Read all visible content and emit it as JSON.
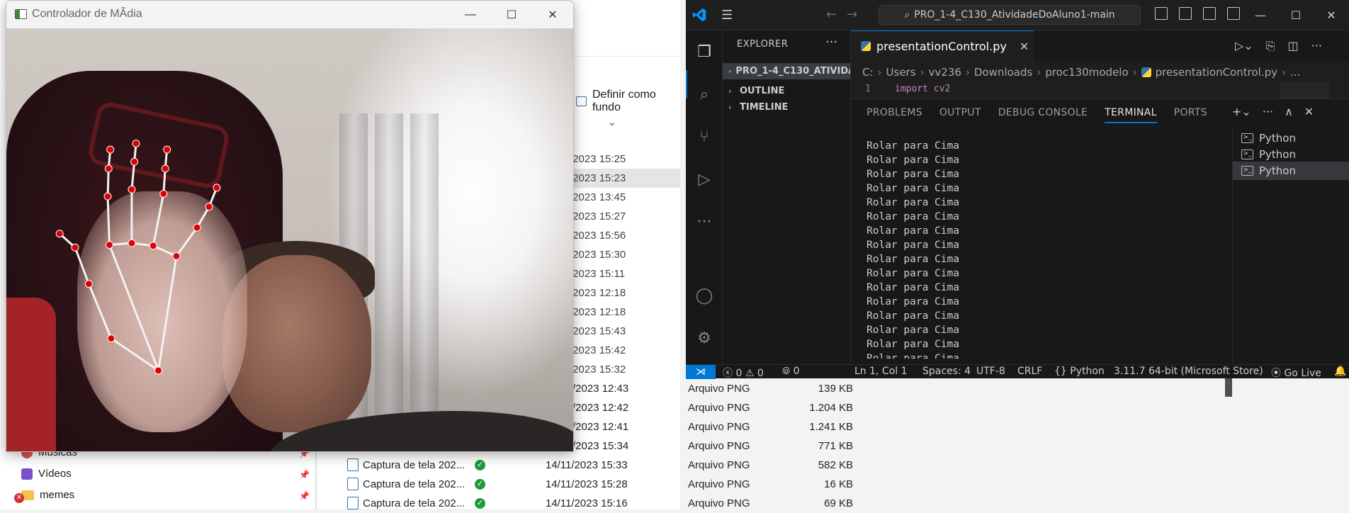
{
  "explorer": {
    "toolbar_label": "Definir como fundo",
    "rows": [
      {
        "date": "/2023 15:25",
        "selected": false
      },
      {
        "date": "/2023 15:23",
        "selected": true
      },
      {
        "date": "/2023 13:45",
        "selected": false
      },
      {
        "date": "/2023 15:27",
        "selected": false
      },
      {
        "date": "/2023 15:56",
        "selected": false
      },
      {
        "date": "/2023 15:30",
        "selected": false
      },
      {
        "date": "/2023 15:11",
        "selected": false
      },
      {
        "date": "/2023 12:18",
        "selected": false
      },
      {
        "date": "/2023 12:18",
        "selected": false
      },
      {
        "date": "/2023 15:43",
        "selected": false
      },
      {
        "date": "/2023 15:42",
        "selected": false
      },
      {
        "date": "/2023 15:32",
        "selected": false
      }
    ],
    "files": [
      {
        "name": "",
        "date": "/2023 12:43",
        "type": "Arquivo PNG",
        "size": "139 KB"
      },
      {
        "name": "",
        "date": "/2023 12:42",
        "type": "Arquivo PNG",
        "size": "1.204 KB"
      },
      {
        "name": "",
        "date": "/2023 12:41",
        "type": "Arquivo PNG",
        "size": "1.241 KB"
      },
      {
        "name": "",
        "date": "/2023 15:34",
        "type": "Arquivo PNG",
        "size": "771 KB"
      },
      {
        "name": "Captura de tela 202...",
        "date": "14/11/2023 15:33",
        "type": "Arquivo PNG",
        "size": "582 KB"
      },
      {
        "name": "Captura de tela 202...",
        "date": "14/11/2023 15:28",
        "type": "Arquivo PNG",
        "size": "16 KB"
      },
      {
        "name": "Captura de tela 202...",
        "date": "14/11/2023 15:16",
        "type": "Arquivo PNG",
        "size": "69 KB"
      }
    ],
    "sidebar": [
      {
        "label": "Músicas",
        "icon": "music-icon"
      },
      {
        "label": "Vídeos",
        "icon": "video-icon"
      },
      {
        "label": "memes",
        "icon": "folder-icon"
      }
    ]
  },
  "camera_window": {
    "title": "Controlador de MÃdia",
    "minimize": "—",
    "maximize": "☐",
    "close": "✕"
  },
  "vscode": {
    "search": "PRO_1-4_C130_AtividadeDoAluno1-main",
    "explorer_title": "EXPLORER",
    "sections": [
      {
        "label": "PRO_1-4_C130_ATIVIDADE...",
        "highlighted": true
      },
      {
        "label": "OUTLINE",
        "highlighted": false
      },
      {
        "label": "TIMELINE",
        "highlighted": false
      }
    ],
    "tab": {
      "label": "presentationControl.py"
    },
    "breadcrumb": [
      "C:",
      "Users",
      "vv236",
      "Downloads",
      "proc130modelo",
      "presentationControl.py",
      "..."
    ],
    "code": {
      "line_number": "1",
      "text": "import cv2"
    },
    "panel_tabs": [
      {
        "label": "PROBLEMS",
        "active": false
      },
      {
        "label": "OUTPUT",
        "active": false
      },
      {
        "label": "DEBUG CONSOLE",
        "active": false
      },
      {
        "label": "TERMINAL",
        "active": true
      },
      {
        "label": "PORTS",
        "active": false
      }
    ],
    "terminal_lines": [
      "Rolar para Cima",
      "Rolar para Cima",
      "Rolar para Cima",
      "Rolar para Cima",
      "Rolar para Cima",
      "Rolar para Cima",
      "Rolar para Cima",
      "Rolar para Cima",
      "Rolar para Cima",
      "Rolar para Cima",
      "Rolar para Cima",
      "Rolar para Cima",
      "Rolar para Cima",
      "Rolar para Cima",
      "Rolar para Cima",
      "Rolar para Cima"
    ],
    "terminals": [
      {
        "label": "Python",
        "selected": false
      },
      {
        "label": "Python",
        "selected": false
      },
      {
        "label": "Python",
        "selected": true
      }
    ],
    "status": {
      "errors": "0",
      "warnings": "0",
      "ports": "0",
      "position": "Ln 1, Col 1",
      "spaces": "Spaces: 4",
      "encoding": "UTF-8",
      "eol": "CRLF",
      "language": "Python",
      "interpreter": "3.11.7 64-bit (Microsoft Store)",
      "golive": "Go Live"
    }
  }
}
